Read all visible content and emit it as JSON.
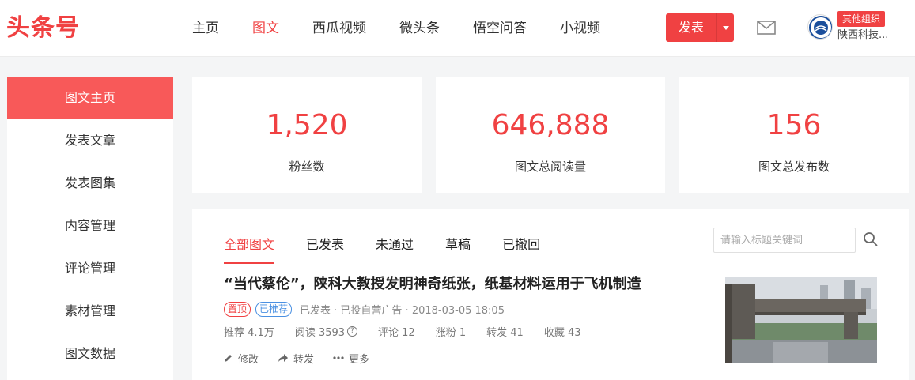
{
  "header": {
    "logo": "头条号",
    "nav": [
      "主页",
      "图文",
      "西瓜视频",
      "微头条",
      "悟空问答",
      "小视频"
    ],
    "active_nav": 1,
    "publish_label": "发表",
    "org_badge": "其他组织",
    "user_name": "陕西科技..."
  },
  "sidebar": {
    "items": [
      "图文主页",
      "发表文章",
      "发表图集",
      "内容管理",
      "评论管理",
      "素材管理",
      "图文数据"
    ],
    "active": 0
  },
  "stats": [
    {
      "value": "1,520",
      "label": "粉丝数"
    },
    {
      "value": "646,888",
      "label": "图文总阅读量"
    },
    {
      "value": "156",
      "label": "图文总发布数"
    }
  ],
  "content": {
    "tabs": [
      "全部图文",
      "已发表",
      "未通过",
      "草稿",
      "已撤回"
    ],
    "active_tab": 0,
    "search_placeholder": "请输入标题关键词",
    "article": {
      "title": "“当代蔡伦”，陕科大教授发明神奇纸张，纸基材料运用于飞机制造",
      "badge_top": "置顶",
      "badge_rec": "已推荐",
      "meta": "已发表 · 已投自营广告 · 2018-03-05 18:05",
      "stats": [
        "推荐 4.1万",
        "阅读 3593",
        "评论 12",
        "涨粉 1",
        "转发 41",
        "收藏 43"
      ],
      "actions": [
        "修改",
        "转发",
        "更多"
      ]
    }
  },
  "colors": {
    "accent": "#f04142",
    "sidebar_active": "#f85959",
    "rec_blue": "#4a90e2"
  }
}
